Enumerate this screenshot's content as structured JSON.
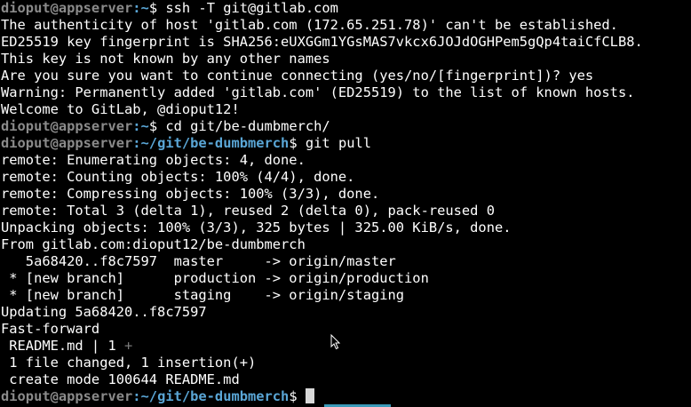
{
  "prompt": {
    "user_host": "dioput@appserver",
    "home_path": ":~",
    "repo_path": ":~/git/be-dumbmerch",
    "symbol": "$"
  },
  "lines": {
    "l1_cmd": " ssh -T git@gitlab.com",
    "l2": "The authenticity of host 'gitlab.com (172.65.251.78)' can't be established.",
    "l3": "ED25519 key fingerprint is SHA256:eUXGGm1YGsMAS7vkcx6JOJdOGHPem5gQp4taiCfCLB8.",
    "l4": "This key is not known by any other names",
    "l5": "Are you sure you want to continue connecting (yes/no/[fingerprint])? yes",
    "l6": "Warning: Permanently added 'gitlab.com' (ED25519) to the list of known hosts.",
    "l7": "Welcome to GitLab, @dioput12!",
    "l8_cmd": " cd git/be-dumbmerch/",
    "l9_cmd": " git pull",
    "l10": "remote: Enumerating objects: 4, done.",
    "l11": "remote: Counting objects: 100% (4/4), done.",
    "l12": "remote: Compressing objects: 100% (3/3), done.",
    "l13": "remote: Total 3 (delta 1), reused 2 (delta 0), pack-reused 0",
    "l14": "Unpacking objects: 100% (3/3), 325 bytes | 325.00 KiB/s, done.",
    "l15": "From gitlab.com:dioput12/be-dumbmerch",
    "l16": "   5a68420..f8c7597  master     -> origin/master",
    "l17": " * [new branch]      production -> origin/production",
    "l18": " * [new branch]      staging    -> origin/staging",
    "l19": "Updating 5a68420..f8c7597",
    "l20": "Fast-forward",
    "l21_text": " README.md | 1 ",
    "l21_plus": "+",
    "l22": " 1 file changed, 1 insertion(+)",
    "l23": " create mode 100644 README.md"
  },
  "colors": {
    "background": "#000000",
    "text": "#ffffff",
    "user_host": "#8a8a8a",
    "path": "#5aa6d6",
    "cursor": "#d8d8d8",
    "accent_bar": "#3a9ab8"
  },
  "icons": {
    "cursor": "text-cursor-block",
    "pointer": "mouse-pointer-icon"
  }
}
